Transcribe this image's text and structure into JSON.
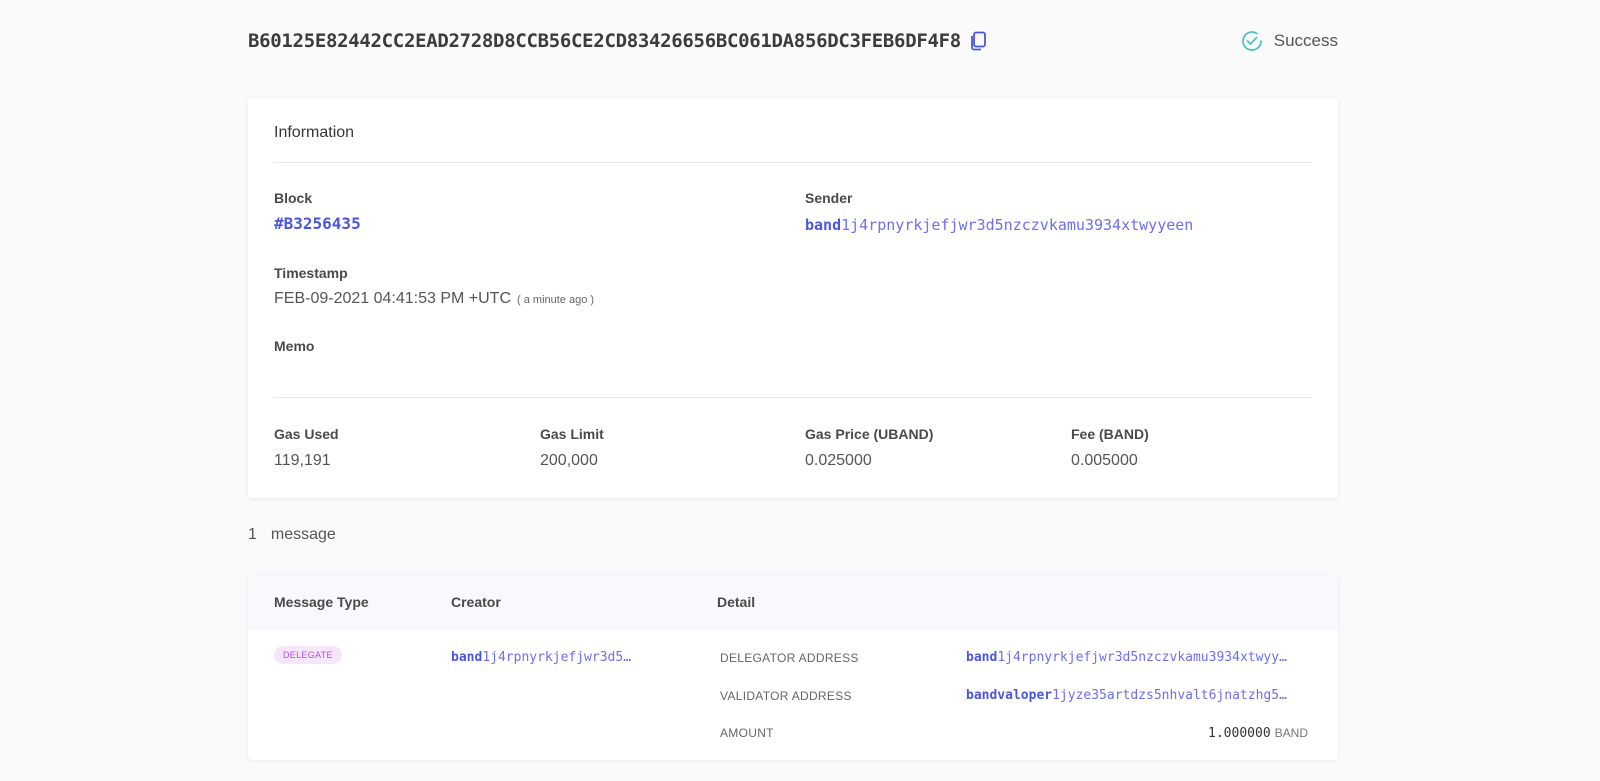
{
  "header": {
    "tx_hash": "B60125E82442CC2EAD2728D8CCB56CE2CD83426656BC061DA856DC3FEB6DF4F8",
    "status": "Success",
    "copy_icon": "copy-icon",
    "status_icon": "check-circle-icon"
  },
  "info": {
    "title": "Information",
    "block_label": "Block",
    "block_value": "#B3256435",
    "sender_label": "Sender",
    "sender_prefix": "band",
    "sender_rest": "1j4rpnyrkjefjwr3d5nzczvkamu3934xtwyyeen",
    "timestamp_label": "Timestamp",
    "timestamp_value": "FEB-09-2021 04:41:53 PM +UTC",
    "timestamp_ago": "( a minute ago )",
    "memo_label": "Memo",
    "memo_value": "",
    "gas_used_label": "Gas Used",
    "gas_used_value": "119,191",
    "gas_limit_label": "Gas Limit",
    "gas_limit_value": "200,000",
    "gas_price_label": "Gas Price (UBAND)",
    "gas_price_value": "0.025000",
    "fee_label": "Fee (BAND)",
    "fee_value": "0.005000"
  },
  "messages": {
    "count": "1",
    "count_label": "message",
    "headers": {
      "type": "Message Type",
      "creator": "Creator",
      "detail": "Detail"
    },
    "row": {
      "type_badge": "DELEGATE",
      "creator_prefix": "band",
      "creator_rest": "1j4rpnyrkjefjwr3d5…",
      "delegator_label": "DELEGATOR ADDRESS",
      "delegator_prefix": "band",
      "delegator_rest": "1j4rpnyrkjefjwr3d5nzczvkamu3934xtwyy…",
      "validator_label": "VALIDATOR ADDRESS",
      "validator_prefix": "bandvaloper",
      "validator_rest": "1jyze35artdzs5nhvalt6jnatzhg5…",
      "amount_label": "AMOUNT",
      "amount_value": "1.000000",
      "amount_unit": "BAND"
    }
  },
  "colors": {
    "accent": "#4b56e0",
    "success": "#3fc1b5",
    "badge_bg": "#f6e6fb",
    "badge_text": "#b150d8"
  }
}
